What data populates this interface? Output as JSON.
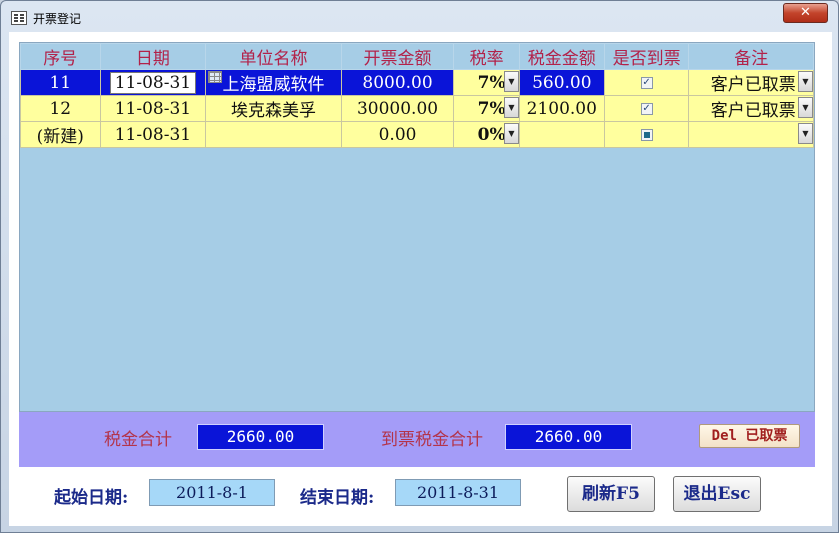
{
  "window": {
    "title": "开票登记",
    "close_label": "✕"
  },
  "grid": {
    "columns": [
      "序号",
      "日期",
      "单位名称",
      "开票金额",
      "税率",
      "税金金额",
      "是否到票",
      "备注"
    ],
    "rows": [
      {
        "seq": "11",
        "date": "11-08-31",
        "company": "上海盟威软件",
        "amount": "8000.00",
        "rate": "7%",
        "tax": "560.00",
        "arrived": true,
        "note": "客户已取票"
      },
      {
        "seq": "12",
        "date": "11-08-31",
        "company": "埃克森美孚",
        "amount": "30000.00",
        "rate": "7%",
        "tax": "2100.00",
        "arrived": true,
        "note": "客户已取票"
      },
      {
        "seq": "(新建)",
        "date": "11-08-31",
        "company": "",
        "amount": "0.00",
        "rate": "0%",
        "tax": "",
        "arrived": null,
        "note": ""
      }
    ]
  },
  "totals": {
    "tax_total_label": "税金合计",
    "tax_total_value": "2660.00",
    "arrived_tax_total_label": "到票税金合计",
    "arrived_tax_total_value": "2660.00",
    "delete_button_label": "Del 已取票"
  },
  "filter": {
    "start_label": "起始日期:",
    "start_value": "2011-8-1",
    "end_label": "结束日期:",
    "end_value": "2011-8-31"
  },
  "actions": {
    "refresh_label": "刷新F5",
    "exit_label": "退出Esc"
  },
  "colors": {
    "grid_background": "#a6cde6",
    "row_background": "#ffff9e",
    "selected_row": "#0a14d8",
    "header_text": "#b2224a",
    "totals_band": "#a49cf8"
  }
}
